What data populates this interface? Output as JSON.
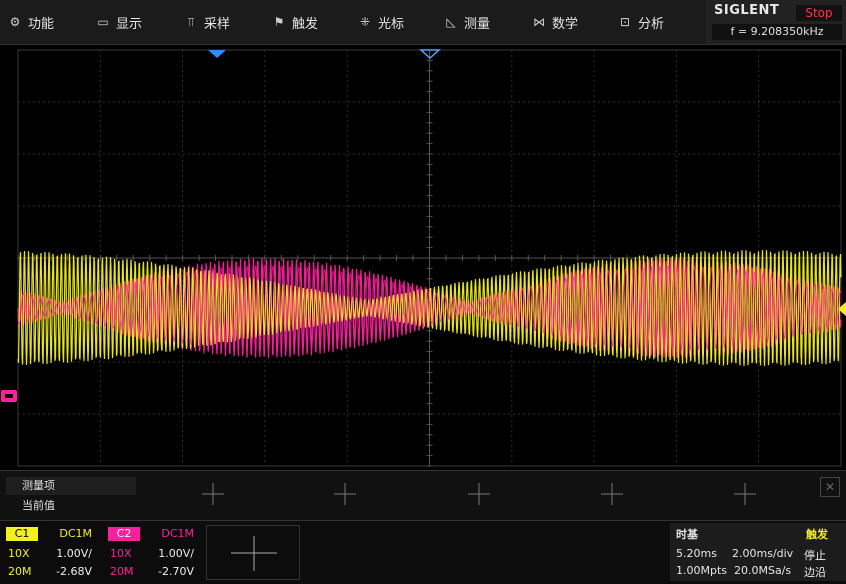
{
  "menu": [
    {
      "label": "功能",
      "icon": "gear-icon",
      "glyph": "⚙"
    },
    {
      "label": "显示",
      "icon": "monitor-icon",
      "glyph": "▭"
    },
    {
      "label": "采样",
      "icon": "acquire-icon",
      "glyph": "⫪"
    },
    {
      "label": "触发",
      "icon": "flag-icon",
      "glyph": "⚑"
    },
    {
      "label": "光标",
      "icon": "cursor-icon",
      "glyph": "⁜"
    },
    {
      "label": "测量",
      "icon": "ruler-icon",
      "glyph": "◺"
    },
    {
      "label": "数学",
      "icon": "math-icon",
      "glyph": "⋈"
    },
    {
      "label": "分析",
      "icon": "analyze-icon",
      "glyph": "⊡"
    }
  ],
  "brand": {
    "name": "SIGLENT",
    "run_state": "Stop",
    "frequency": "f = 9.208350kHz"
  },
  "measure": {
    "title": "测量项",
    "current": "当前值"
  },
  "channels": {
    "c1": {
      "name": "C1",
      "coupling": "DC1M",
      "probe": "10X",
      "scale": "1.00V/",
      "bw": "20M",
      "offset": "-2.68V",
      "color": "#f4f01e"
    },
    "c2": {
      "name": "C2",
      "coupling": "DC1M",
      "probe": "10X",
      "scale": "1.00V/",
      "bw": "20M",
      "offset": "-2.70V",
      "color": "#ff1e9e"
    }
  },
  "timebase": {
    "title": "时基",
    "delay": "5.20ms",
    "per_div": "2.00ms/div",
    "points": "1.00Mpts",
    "rate": "20.0MSa/s"
  },
  "trigger": {
    "title": "触发",
    "state": "停止",
    "type": "边沿"
  },
  "waveform": {
    "c1_color": "#f4f01e",
    "c2_color": "#ff1e9e",
    "c1_beat_nodes_div": [
      9.0
    ],
    "c2_beat_nodes_div": [
      0.5,
      5.5,
      10.0
    ]
  }
}
